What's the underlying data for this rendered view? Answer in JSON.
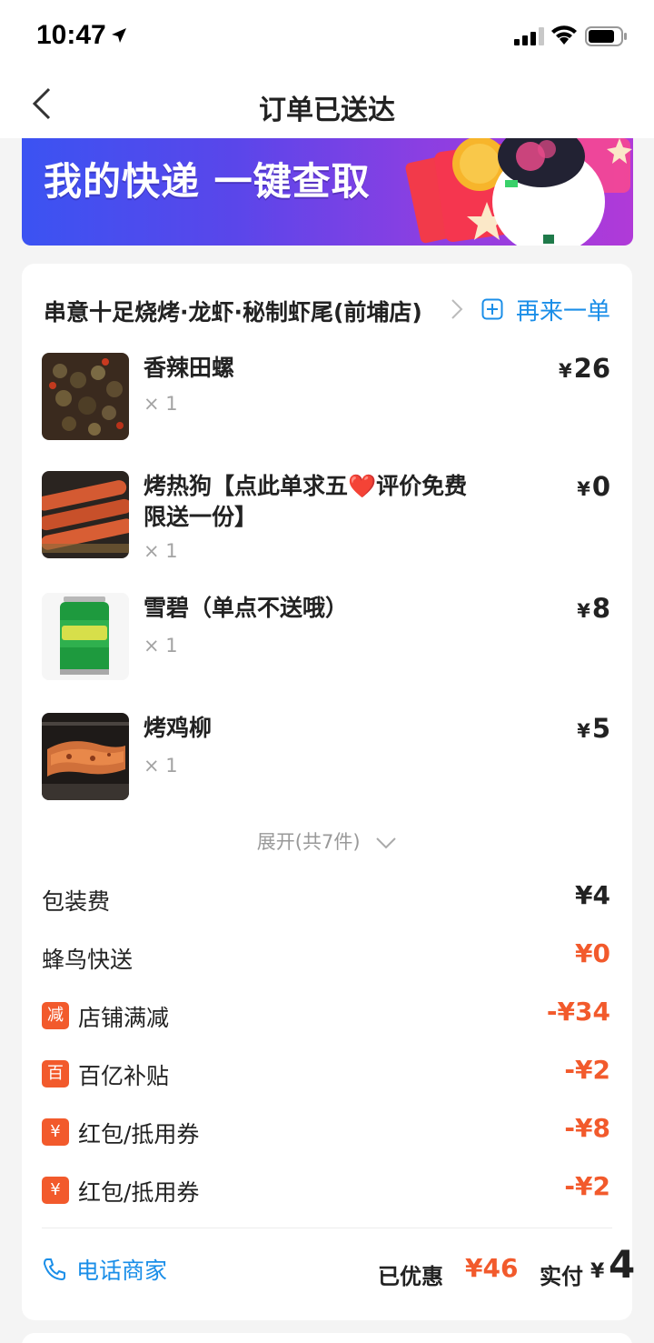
{
  "status_bar": {
    "time": "10:47"
  },
  "nav": {
    "title": "订单已送达"
  },
  "banner": {
    "text": "我的快递 一键查取"
  },
  "order": {
    "shop_name": "串意十足烧烤·龙虾·秘制虾尾(前埔店)",
    "reorder_label": "再来一单",
    "currency": "¥",
    "items": [
      {
        "name": "香辣田螺",
        "qty": "× 1",
        "price": "26",
        "icon": "snail-dish-photo"
      },
      {
        "name": "烤热狗【点此单求五❤️评价免费限送一份】",
        "qty": "× 1",
        "price": "0",
        "icon": "grilled-sausage-photo"
      },
      {
        "name": "雪碧（单点不送哦）",
        "qty": "× 1",
        "price": "8",
        "icon": "sprite-can-photo"
      },
      {
        "name": "烤鸡柳",
        "qty": "× 1",
        "price": "5",
        "icon": "grilled-chicken-photo"
      }
    ],
    "expand_label": "展开(共7件)",
    "fees": [
      {
        "label": "包装费",
        "value": "¥4",
        "color": "#222222"
      },
      {
        "label": "蜂鸟快送",
        "value": "¥0",
        "color": "#f25a2c"
      }
    ],
    "discounts": [
      {
        "badge": "减",
        "label": "店铺满减",
        "value": "-¥34"
      },
      {
        "badge": "百",
        "label": "百亿补贴",
        "value": "-¥2"
      },
      {
        "badge": "¥",
        "label": "红包/抵用券",
        "value": "-¥8"
      },
      {
        "badge": "¥",
        "label": "红包/抵用券",
        "value": "-¥2"
      }
    ],
    "call_label": "电话商家",
    "saved_label": "已优惠",
    "saved_value": "¥46",
    "paid_label": "实付",
    "paid_value": "4"
  },
  "colors": {
    "accent_blue": "#1a8ee8",
    "discount_red": "#f25a2c"
  }
}
